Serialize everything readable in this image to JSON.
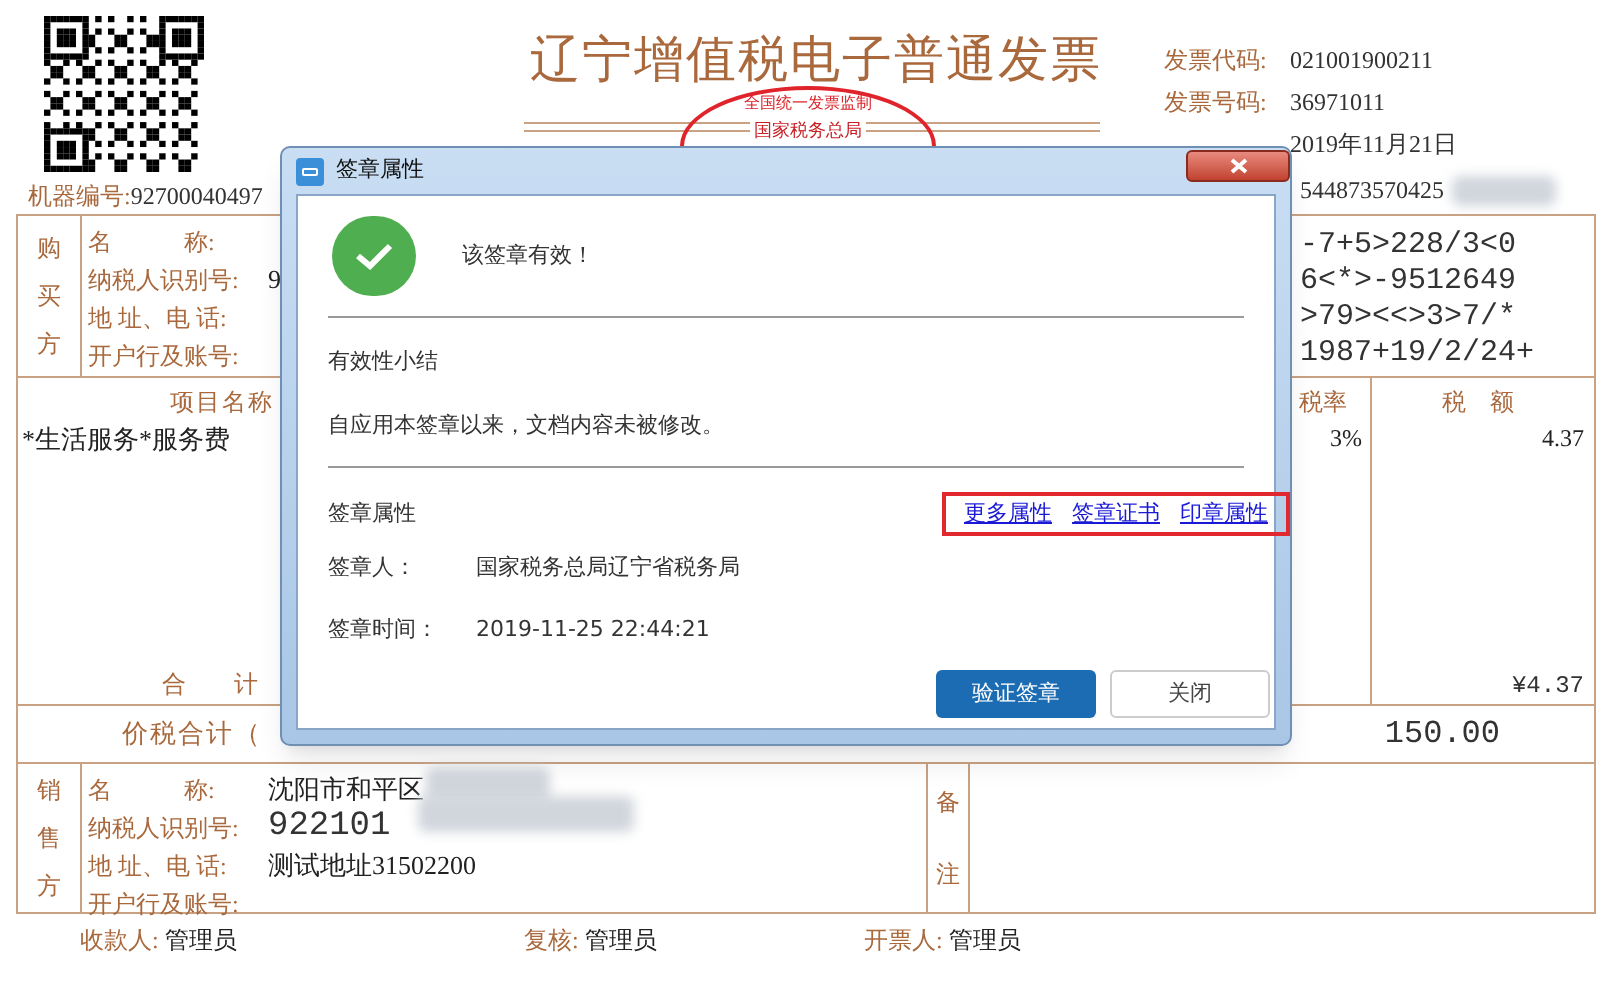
{
  "invoice": {
    "title": "辽宁增值税电子普通发票",
    "stamp": {
      "top_text": "全国统一发票监制",
      "bottom_text": "国家税务总局"
    },
    "machine_no": {
      "label": "机器编号:",
      "value": "92700040497"
    },
    "meta": [
      {
        "label": "发票代码:",
        "value": "021001900211"
      },
      {
        "label": "发票号码:",
        "value": "36971011"
      },
      {
        "value": "2019年11月21日"
      }
    ],
    "check_code": "544873570425",
    "buyer": {
      "side_label": "购买方",
      "fields": [
        {
          "label": "名　　　称:"
        },
        {
          "label": "纳税人识别号:",
          "value": "9"
        },
        {
          "label": "地 址、电 话:"
        },
        {
          "label": "开户行及账号:"
        }
      ]
    },
    "cipher": [
      "-7+5>228/3<0",
      "6<*>-9512649",
      ">79><<>3>7/*",
      "1987+19/2/24+"
    ],
    "items": {
      "headers": [
        "项目名称",
        "税率",
        "税　额"
      ],
      "rows": [
        {
          "name": "*生活服务*服务费",
          "rate": "3%",
          "tax": "4.37"
        }
      ],
      "total_label": "合　　计",
      "total_tax": "¥4.37"
    },
    "grand_total": {
      "label": "价税合计（",
      "amount": "150.00"
    },
    "seller": {
      "side_label": "销售方",
      "fields": [
        {
          "label": "名　　　称:",
          "value": "沈阳市和平区"
        },
        {
          "label": "纳税人识别号:",
          "value": "922101",
          "mono": true
        },
        {
          "label": "地 址、电 话:",
          "value": "测试地址31502200"
        },
        {
          "label": "开户行及账号:"
        }
      ],
      "remark_label": "备注"
    },
    "footer": [
      {
        "label": "收款人:",
        "value": "管理员"
      },
      {
        "label": "复核:",
        "value": "管理员"
      },
      {
        "label": "开票人:",
        "value": "管理员"
      }
    ]
  },
  "dialog": {
    "title": "签章属性",
    "status": "该签章有效！",
    "valid": true,
    "summary_heading": "有效性小结",
    "summary_text": "自应用本签章以来，文档内容未被修改。",
    "props_heading": "签章属性",
    "links": [
      "更多属性",
      "签章证书",
      "印章属性"
    ],
    "fields": [
      {
        "label": "签章人：",
        "value": "国家税务总局辽宁省税务局"
      },
      {
        "label": "签章时间：",
        "value": "2019-11-25 22:44:21"
      }
    ],
    "buttons": [
      {
        "label": "验证签章",
        "kind": "primary"
      },
      {
        "label": "关闭",
        "kind": "default"
      }
    ]
  }
}
